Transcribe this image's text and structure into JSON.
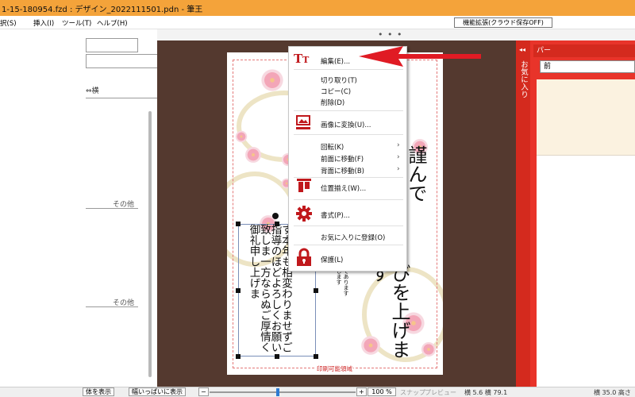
{
  "window": {
    "title": "1-15-180954.fzd : デザイン_2022111501.pdn - 筆王"
  },
  "menubar": {
    "items": [
      "択(S)",
      "挿入(I)",
      "ツール(T)",
      "ヘルプ(H)"
    ],
    "cloud_button": "機能拡張(クラウド保存OFF)"
  },
  "left_panel": {
    "label_horizontal": "⇔横",
    "other_link_1": "その他",
    "other_link_2": "その他"
  },
  "canvas": {
    "big_text_1": "謹んで",
    "big_text_2": "びを上げます",
    "small_text": "うき年であります|りいたします|よう|九日",
    "selected_text": "す本年も相変わりませずご指導のほどよろしくお願い致しま一方ならぬご厚情く御礼申し上げま",
    "print_area_label": "印刷可能領域"
  },
  "context_menu": {
    "items": [
      {
        "label": "編集(E)...",
        "icon": "text-edit-icon"
      },
      {
        "label": "切り取り(T)"
      },
      {
        "label": "コピー(C)"
      },
      {
        "label": "削除(D)"
      },
      {
        "label": "画像に変換(U)...",
        "icon": "image-convert-icon"
      },
      {
        "label": "回転(K)",
        "submenu": true
      },
      {
        "label": "前面に移動(F)",
        "submenu": true
      },
      {
        "label": "背面に移動(B)",
        "submenu": true
      },
      {
        "label": "位置揃え(W)...",
        "icon": "align-icon"
      },
      {
        "label": "書式(P)...",
        "icon": "gear-icon"
      },
      {
        "label": "お気に入りに登録(O)"
      },
      {
        "label": "保護(L)",
        "icon": "lock-icon"
      }
    ],
    "submenu_glyph": "›"
  },
  "right_panel": {
    "favorites_label": "お気に入り",
    "collapse_glyph": "◂◂",
    "tab_label": "パー",
    "button_label": "前"
  },
  "statusbar": {
    "show_all": "体を表示",
    "fit_width": "幅いっぱいに表示",
    "zoom_minus": "−",
    "zoom_plus": "+",
    "zoom_value": "100 %",
    "snap": "スナップ",
    "preview": "プレビュー",
    "width_readout": "横 5.6 横 79.1",
    "height_readout": "横 35.0 高さ"
  },
  "colors": {
    "titlebar": "#f4a33a",
    "canvas_bg": "#54392f",
    "accent_red": "#d42a1e",
    "arrow_red": "#e01b24"
  }
}
